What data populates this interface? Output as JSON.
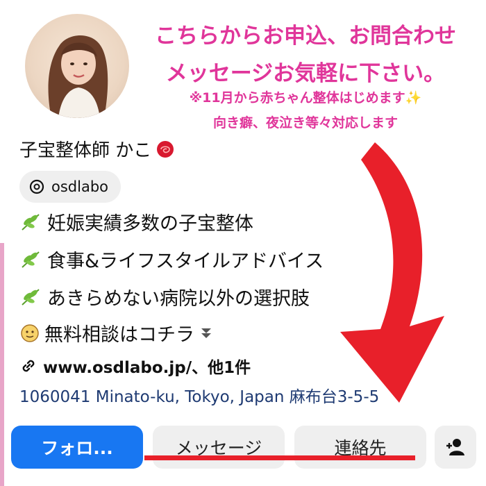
{
  "promo": {
    "line1": "こちらからお申込、お問合わせ",
    "line2": "メッセージお気軽に下さい。",
    "line3": "※11月から赤ちゃん整体はじめます✨",
    "line4": "向き癖、夜泣き等々対応します"
  },
  "profile": {
    "name": "子宝整体師 かこ",
    "threads_handle": "osdlabo",
    "bio": [
      "妊娠実績多数の子宝整体",
      "食事&ライフスタイルアドバイス",
      "あきらめない病院以外の選択肢",
      "無料相談はコチラ"
    ],
    "link": "www.osdlabo.jp/、他1件",
    "address": "1060041 Minato-ku, Tokyo, Japan 麻布台3-5-5"
  },
  "buttons": {
    "follow": "フォロ...",
    "message": "メッセージ",
    "contact": "連絡先"
  },
  "colors": {
    "promo_text": "#e0359a",
    "follow_button": "#1877f2",
    "arrow": "#e8202a",
    "address_text": "#1e3a72"
  }
}
